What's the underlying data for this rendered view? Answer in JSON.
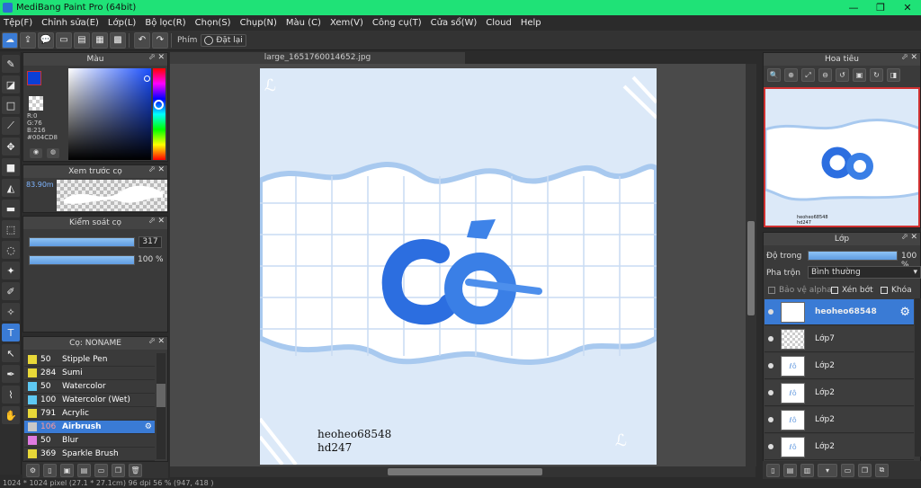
{
  "window": {
    "title": "MediBang Paint Pro (64bit)",
    "minimize": "—",
    "maximize": "❐",
    "close": "✕"
  },
  "menu": [
    "Tệp(F)",
    "Chỉnh sửa(E)",
    "Lớp(L)",
    "Bộ lọc(R)",
    "Chọn(S)",
    "Chụp(N)",
    "Màu (C)",
    "Xem(V)",
    "Công cụ(T)",
    "Cửa sổ(W)",
    "Cloud",
    "Help"
  ],
  "toolbar": {
    "shortcut_label": "Phím",
    "reset_label": "Đặt lại"
  },
  "color_panel": {
    "title": "Màu",
    "r": "R:0",
    "g": "G:76",
    "b": "B:216",
    "hex": "#004CD8",
    "fg": "#0b3fd6",
    "bg": "#e7eef7"
  },
  "brush_preview": {
    "title": "Xem trước cọ",
    "size": "83.90m"
  },
  "brush_control": {
    "title": "Kiểm soát cọ",
    "size_value": "317",
    "size_fill": 1.0,
    "opacity_value": "100 %",
    "opacity_fill": 1.0
  },
  "brush_list": {
    "title": "Cọ: NONAME",
    "items": [
      {
        "size": "50",
        "name": "Stipple Pen",
        "color": "#e8d838"
      },
      {
        "size": "284",
        "name": "Sumi",
        "color": "#e8d838"
      },
      {
        "size": "50",
        "name": "Watercolor",
        "color": "#5ec8f2"
      },
      {
        "size": "100",
        "name": "Watercolor (Wet)",
        "color": "#5ec8f2"
      },
      {
        "size": "791",
        "name": "Acrylic",
        "color": "#e8d838"
      },
      {
        "size": "106",
        "name": "Airbrush",
        "color": "#c8c8c8",
        "selected": true
      },
      {
        "size": "50",
        "name": "Blur",
        "color": "#e07ae0"
      },
      {
        "size": "369",
        "name": "Sparkle Brush",
        "color": "#e8d838"
      }
    ]
  },
  "document": {
    "tab": "large_1651760014652.jpg",
    "signature_line1": "heoheo68548",
    "signature_line2": "hd247",
    "title_art": "Cỏ"
  },
  "navigator": {
    "title": "Hoa tiêu",
    "thumb_text1": "heoheo68548",
    "thumb_text2": "hd247"
  },
  "layers": {
    "title": "Lớp",
    "opacity_label": "Độ trong",
    "opacity_value": "100 %",
    "opacity_fill": 1.0,
    "blend_label": "Pha trộn",
    "blend_value": "Bình thường",
    "protect_alpha": "Bảo vệ alpha",
    "clipping": "Xén bớt",
    "lock": "Khóa",
    "items": [
      {
        "name": "heoheo68548",
        "selected": true
      },
      {
        "name": "Lớp7"
      },
      {
        "name": "Lớp2"
      },
      {
        "name": "Lớp2"
      },
      {
        "name": "Lớp2"
      },
      {
        "name": "Lớp2"
      }
    ]
  },
  "status": {
    "text": "1024 * 1024 pixel (27.1 * 27.1cm) 96 dpi 56 % (947, 418 )"
  }
}
